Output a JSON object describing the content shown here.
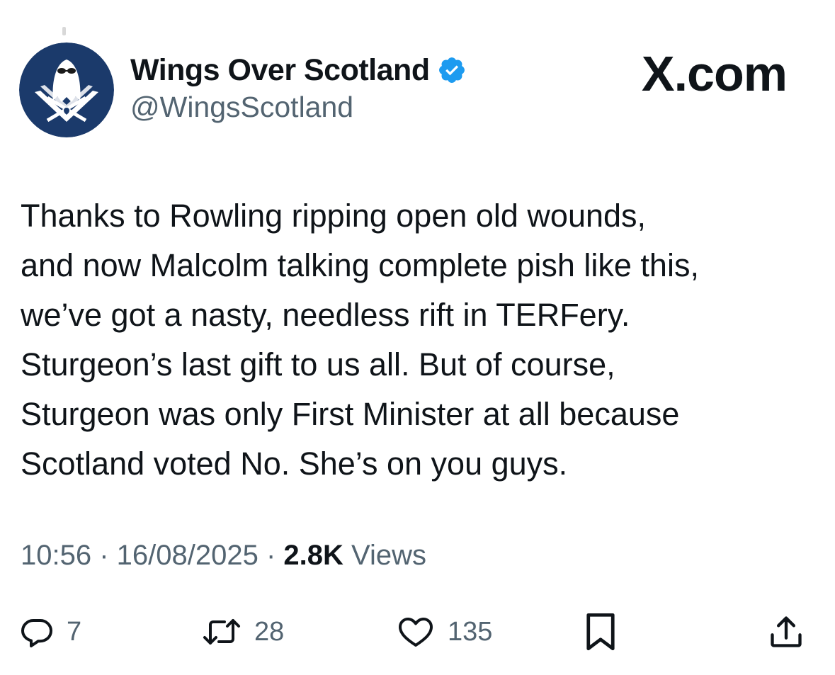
{
  "header": {
    "display_name": "Wings Over Scotland",
    "handle": "@WingsScotland",
    "verified_icon": "verified-badge-icon",
    "verified_color": "#1d9bf0",
    "avatar_bg": "#1b3a6b",
    "brand": "X.com"
  },
  "tweet": {
    "lines": [
      "Thanks to Rowling ripping open old wounds,",
      "and now Malcolm talking complete pish like this,",
      "we’ve got a nasty, needless rift in TERFery.",
      "Sturgeon’s last gift to us all. But of course,",
      "Sturgeon was only First Minister at all because",
      "Scotland voted No. She’s on you guys."
    ]
  },
  "meta": {
    "time": "10:56",
    "separator": " · ",
    "date": "16/08/2025",
    "views_count": "2.8K",
    "views_label": " Views"
  },
  "actions": {
    "reply": {
      "icon": "reply-icon",
      "count": "7"
    },
    "repost": {
      "icon": "repost-icon",
      "count": "28"
    },
    "like": {
      "icon": "heart-icon",
      "count": "135"
    },
    "bookmark": {
      "icon": "bookmark-icon"
    },
    "share": {
      "icon": "share-icon"
    }
  },
  "colors": {
    "text": "#0f1419",
    "secondary": "#536471",
    "background": "#ffffff"
  }
}
